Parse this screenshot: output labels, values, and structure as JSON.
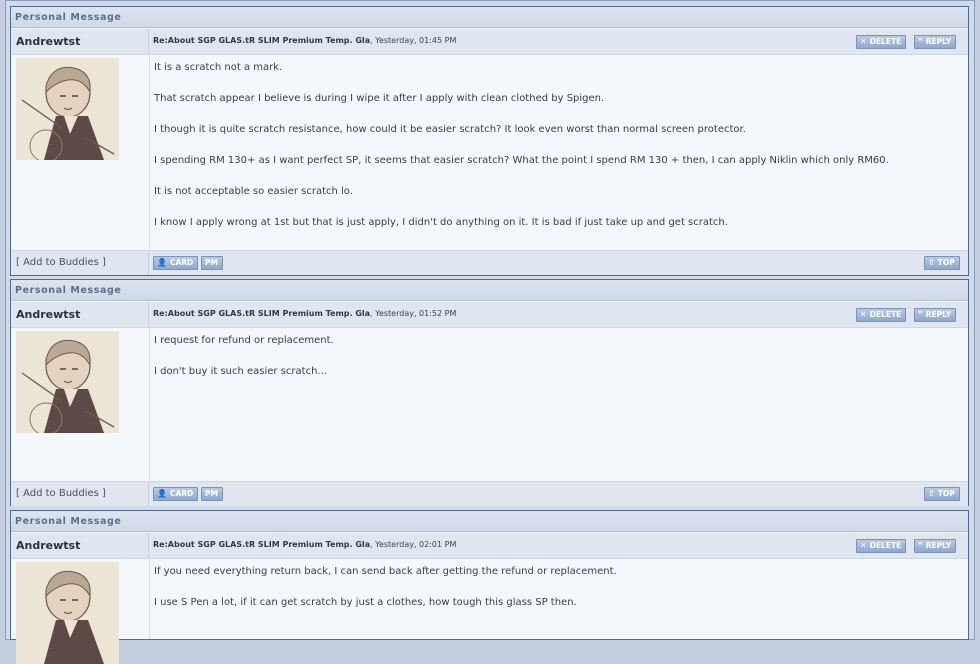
{
  "labels": {
    "section_title": "Personal Message",
    "delete": "DELETE",
    "reply": "REPLY",
    "card": "CARD",
    "pm": "PM",
    "top": "TOP",
    "add_buddies": "[ Add to Buddies ]"
  },
  "posts": [
    {
      "author": "Andrewtst",
      "subject": "Re:About SGP GLAS.tR SLIM Premium Temp. Gla",
      "time": ", Yesterday, 01:45 PM",
      "paragraphs": [
        "It is a scratch not a mark.",
        "That scratch appear I believe is during I wipe it after I apply with clean clothed by Spigen.",
        "I though it is quite scratch resistance, how could it be easier scratch? It look even worst than normal screen protector.",
        "I spending RM 130+ as I want perfect SP, it seems that easier scratch? What the point I spend RM 130 + then, I can apply Niklin which only RM60.",
        "It is not acceptable so easier scratch lo.",
        "I know I apply wrong at 1st but that is just apply, I didn't do anything on it. It is bad if just take up and get scratch."
      ]
    },
    {
      "author": "Andrewtst",
      "subject": "Re:About SGP GLAS.tR SLIM Premium Temp. Gla",
      "time": ", Yesterday, 01:52 PM",
      "paragraphs": [
        "I request for refund or replacement.",
        "I don't buy it such easier scratch..."
      ]
    },
    {
      "author": "Andrewtst",
      "subject": "Re:About SGP GLAS.tR SLIM Premium Temp. Gla",
      "time": ", Yesterday, 02:01 PM",
      "paragraphs": [
        "If you need everything return back, I can send back after getting the refund or replacement.",
        "I use S Pen a lot, if it can get scratch by just a clothes, how tough this glass SP then."
      ]
    }
  ]
}
